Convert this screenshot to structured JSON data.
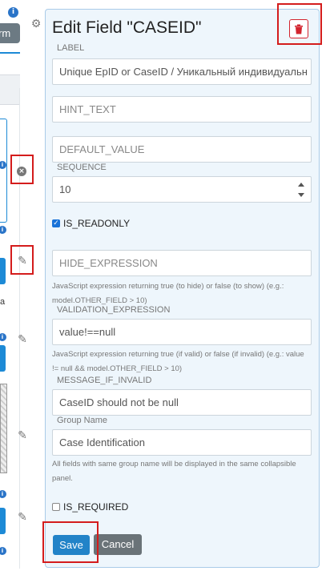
{
  "background": {
    "info_glyph": "i",
    "button_fragment": "rm",
    "letter_fragment": "а",
    "edit_glyph": "✎",
    "gear_glyph": "⚙",
    "remove_glyph": "×"
  },
  "panel": {
    "title": "Edit Field \"CASEID\"",
    "fields": {
      "label": {
        "caption": "LABEL",
        "value": "Unique EpID or CaseID / Уникальный индивидуальн"
      },
      "hint_text": {
        "placeholder": "HINT_TEXT"
      },
      "default_value": {
        "placeholder": "DEFAULT_VALUE"
      },
      "sequence": {
        "caption": "SEQUENCE",
        "value": "10"
      },
      "is_readonly": {
        "label": "IS_READONLY",
        "checked": true
      },
      "hide_expression": {
        "placeholder": "HIDE_EXPRESSION",
        "help": "JavaScript expression returning true (to hide) or false (to show) (e.g.: model.OTHER_FIELD > 10)"
      },
      "validation_expression": {
        "caption": "VALIDATION_EXPRESSION",
        "value": "value!==null",
        "help": "JavaScript expression returning true (if valid) or false (if invalid) (e.g.: value != null && model.OTHER_FIELD > 10)"
      },
      "message_if_invalid": {
        "caption": "MESSAGE_IF_INVALID",
        "value": "CaseID should not be null"
      },
      "group_name": {
        "caption": "Group Name",
        "value": "Case Identification",
        "help": "All fields with same group name will be displayed in the same collapsible panel."
      },
      "is_required": {
        "label": "IS_REQUIRED",
        "checked": false
      }
    },
    "buttons": {
      "save": "Save",
      "cancel": "Cancel"
    }
  },
  "colors": {
    "panel_bg": "#eef6fc",
    "primary": "#2283c8",
    "secondary": "#6a7378",
    "danger": "#d3242e",
    "annotation": "#d41c1c"
  },
  "icons": [
    "gear-icon",
    "trash-icon",
    "edit-icon",
    "remove-circle-icon",
    "info-icon",
    "checkbox-checked-icon",
    "spinner-icon"
  ]
}
